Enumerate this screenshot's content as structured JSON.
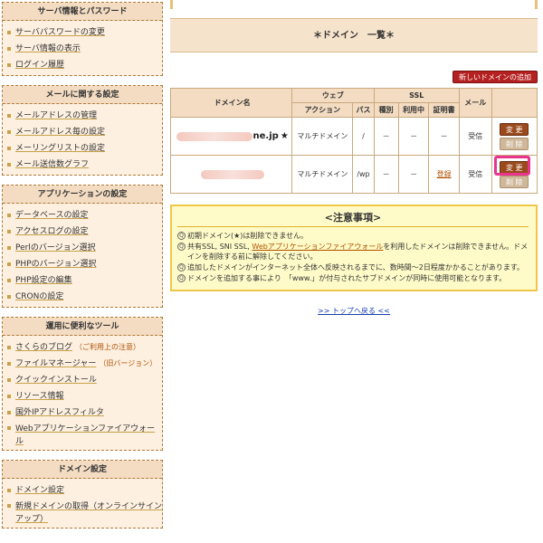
{
  "sidebar": {
    "server": {
      "title": "サーバ情報とパスワード",
      "items": [
        "サーバパスワードの変更",
        "サーバ情報の表示",
        "ログイン履歴"
      ]
    },
    "mail": {
      "title": "メールに関する設定",
      "items": [
        "メールアドレスの管理",
        "メールアドレス毎の設定",
        "メーリングリストの設定",
        "メール送信数グラフ"
      ]
    },
    "app": {
      "title": "アプリケーションの設定",
      "items": [
        "データベースの設定",
        "アクセスログの設定",
        "Perlのバージョン選択",
        "PHPのバージョン選択",
        "PHP設定の編集",
        "CRONの設定"
      ]
    },
    "tools": {
      "title": "運用に便利なツール",
      "items": [
        {
          "label": "さくらのブログ",
          "note": "（ご利用上の注意）"
        },
        {
          "label": "ファイルマネージャー",
          "note": "（旧バージョン）"
        },
        {
          "label": "クイックインストール",
          "note": ""
        },
        {
          "label": "リソース情報",
          "note": ""
        },
        {
          "label": "国外IPアドレスフィルタ",
          "note": ""
        },
        {
          "label": "Webアプリケーションファイアウォール",
          "note": ""
        }
      ]
    },
    "domain": {
      "title": "ドメイン設定",
      "items": [
        "ドメイン設定",
        "新規ドメインの取得（オンラインサインアップ）"
      ]
    }
  },
  "main": {
    "title": "＊ドメイン　一覧＊",
    "add_button": "新しいドメインの追加",
    "table": {
      "headers": {
        "domain": "ドメイン名",
        "web": "ウェブ",
        "ssl": "SSL",
        "mail": "メール",
        "action": "アクション",
        "path": "パス",
        "type": "種別",
        "in_use": "利用中",
        "cert": "証明書"
      },
      "rows": [
        {
          "domain_suffix": "ne.jp",
          "star": "★",
          "action": "マルチドメイン",
          "path": "/",
          "type": "－",
          "in_use": "－",
          "cert": "－",
          "mail": "受信",
          "change": "変 更",
          "delete": "削 除"
        },
        {
          "domain_suffix": "",
          "star": "",
          "action": "マルチドメイン",
          "path": "/wp",
          "type": "－",
          "in_use": "－",
          "cert": "登録",
          "mail": "受信",
          "change": "変 更",
          "delete": "削 除"
        }
      ]
    },
    "notice": {
      "title": "<注意事項>",
      "items": [
        {
          "text": "初期ドメイン(★)は削除できません。"
        },
        {
          "pre": "共有SSL, SNI SSL, ",
          "link": "Webアプリケーションファイアウォール",
          "post": "を利用したドメインは削除できません。ドメインを削除する前に解除してください。"
        },
        {
          "text": "追加したドメインがインターネット全体へ反映されるまでに、数時間〜2日程度かかることがあります。"
        },
        {
          "text": "ドメインを追加する事により　「www.」が付与されたサブドメインが同時に使用可能となります。"
        }
      ]
    },
    "back_link": ">> トップへ戻る <<"
  },
  "colors": {
    "sidebar_bg": "#fdf0e0",
    "accent_red": "#b52020",
    "change_button": "#9b4a1c",
    "highlight": "#e8368f",
    "notice_bg": "#fffbc8"
  }
}
